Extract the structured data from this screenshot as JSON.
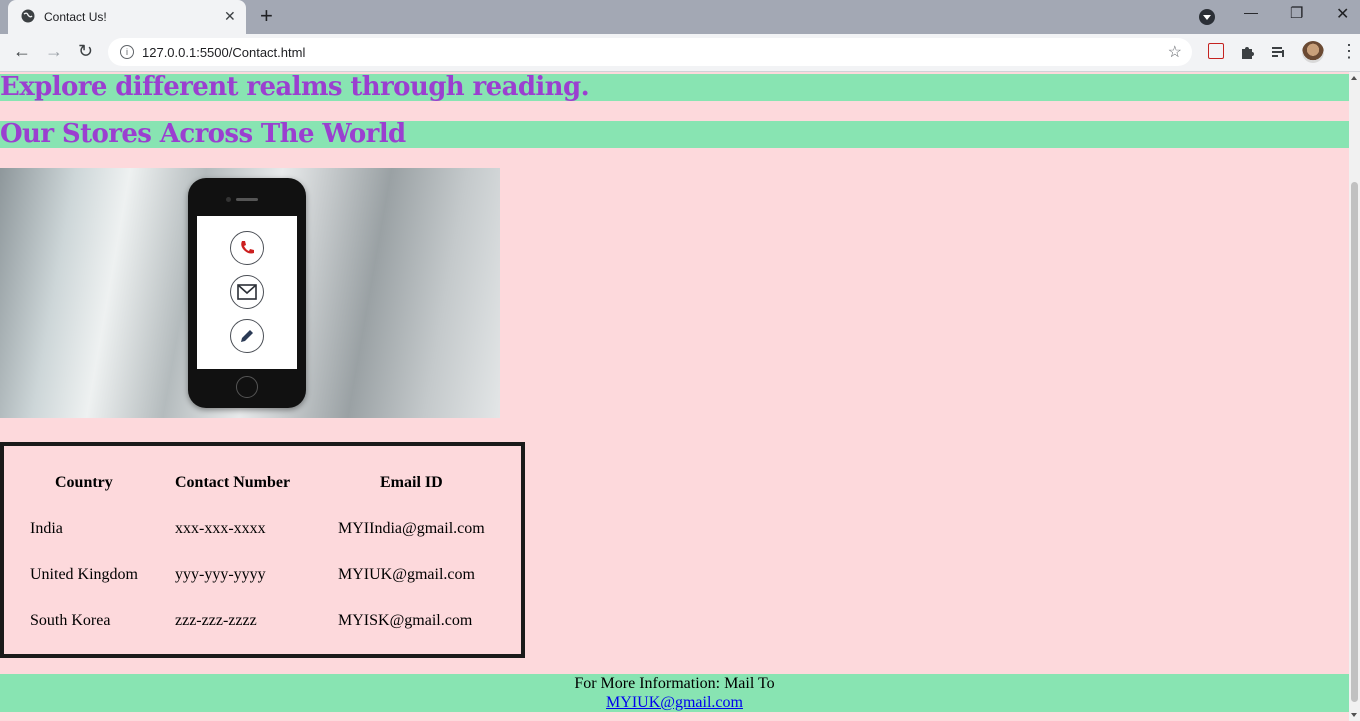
{
  "browser": {
    "tab_title": "Contact Us!",
    "tab_close": "✕",
    "new_tab": "+",
    "url": "127.0.0.1:5500/Contact.html",
    "minimize": "—",
    "restore": "❐",
    "close": "✕",
    "back": "←",
    "forward": "→",
    "reload": "↻",
    "star": "☆",
    "menu": "⋮"
  },
  "page": {
    "tagline": "Explore different realms through reading.",
    "stores_heading": "Our Stores Across The World",
    "table": {
      "headers": [
        "Country",
        "Contact Number",
        "Email ID"
      ],
      "rows": [
        [
          "India",
          "xxx-xxx-xxxx",
          "MYIIndia@gmail.com"
        ],
        [
          "United Kingdom",
          "yyy-yyy-yyyy",
          "MYIUK@gmail.com"
        ],
        [
          "South Korea",
          "zzz-zzz-zzzz",
          "MYISK@gmail.com"
        ]
      ]
    },
    "footer": {
      "text": "For More Information: Mail To",
      "email": "MYIUK@gmail.com"
    }
  },
  "icons": {
    "phone": "phone-icon",
    "mail": "mail-icon",
    "pencil": "pencil-icon"
  },
  "colors": {
    "page_background": "#fdd9dc",
    "band_background": "#88e4b2",
    "heading_color": "#9b3fd0",
    "link_color": "#0000ee",
    "phone_icon": "#cc1f1f"
  }
}
